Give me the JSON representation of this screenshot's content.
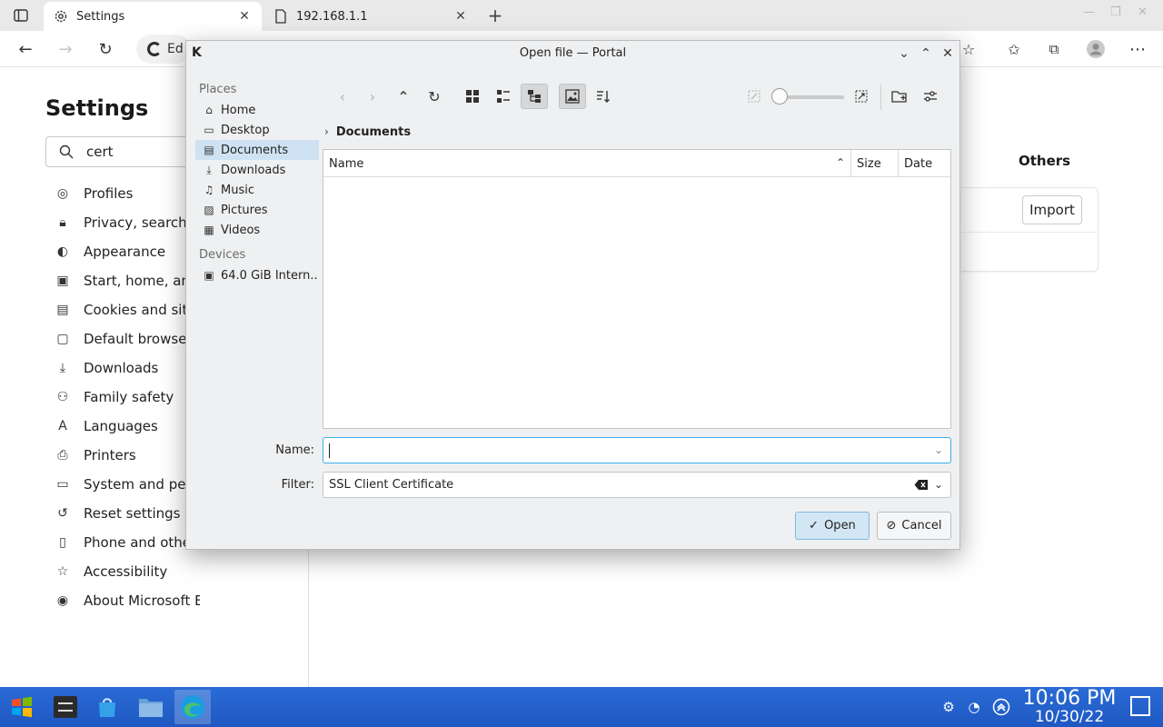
{
  "browser": {
    "tabs": [
      {
        "title": "Settings",
        "active": true
      },
      {
        "title": "192.168.1.1",
        "active": false
      }
    ],
    "address_text": "Ed"
  },
  "settings": {
    "title": "Settings",
    "search_value": "cert",
    "nav_items": [
      {
        "label": "Profiles",
        "icon": "profile-icon"
      },
      {
        "label": "Privacy, search, a",
        "icon": "lock-icon"
      },
      {
        "label": "Appearance",
        "icon": "palette-icon"
      },
      {
        "label": "Start, home, and",
        "icon": "home-icon"
      },
      {
        "label": "Cookies and site",
        "icon": "cookie-icon"
      },
      {
        "label": "Default browser",
        "icon": "browser-icon"
      },
      {
        "label": "Downloads",
        "icon": "download-icon"
      },
      {
        "label": "Family safety",
        "icon": "family-icon"
      },
      {
        "label": "Languages",
        "icon": "language-icon"
      },
      {
        "label": "Printers",
        "icon": "printer-icon"
      },
      {
        "label": "System and perfo",
        "icon": "system-icon"
      },
      {
        "label": "Reset settings",
        "icon": "reset-icon"
      },
      {
        "label": "Phone and other",
        "icon": "phone-icon"
      },
      {
        "label": "Accessibility",
        "icon": "accessibility-icon"
      },
      {
        "label": "About Microsoft Edge",
        "icon": "edge-icon"
      }
    ],
    "others_label": "Others",
    "import_label": "Import"
  },
  "dialog": {
    "title": "Open file — Portal",
    "places_header": "Places",
    "places": [
      {
        "label": "Home",
        "icon": "home-icon"
      },
      {
        "label": "Desktop",
        "icon": "desktop-icon"
      },
      {
        "label": "Documents",
        "icon": "documents-icon",
        "selected": true
      },
      {
        "label": "Downloads",
        "icon": "download-icon"
      },
      {
        "label": "Music",
        "icon": "music-icon"
      },
      {
        "label": "Pictures",
        "icon": "picture-icon"
      },
      {
        "label": "Videos",
        "icon": "video-icon"
      }
    ],
    "devices_header": "Devices",
    "devices": [
      {
        "label": "64.0 GiB Intern...",
        "icon": "drive-icon"
      }
    ],
    "breadcrumb": "Documents",
    "columns": {
      "name": "Name",
      "size": "Size",
      "date": "Date"
    },
    "name_label": "Name:",
    "name_value": "",
    "filter_label": "Filter:",
    "filter_value": "SSL Client Certificate",
    "open_label": "Open",
    "cancel_label": "Cancel",
    "accent_color": "#3daee9"
  },
  "taskbar": {
    "time": "10:06 PM",
    "date": "10/30/22"
  }
}
